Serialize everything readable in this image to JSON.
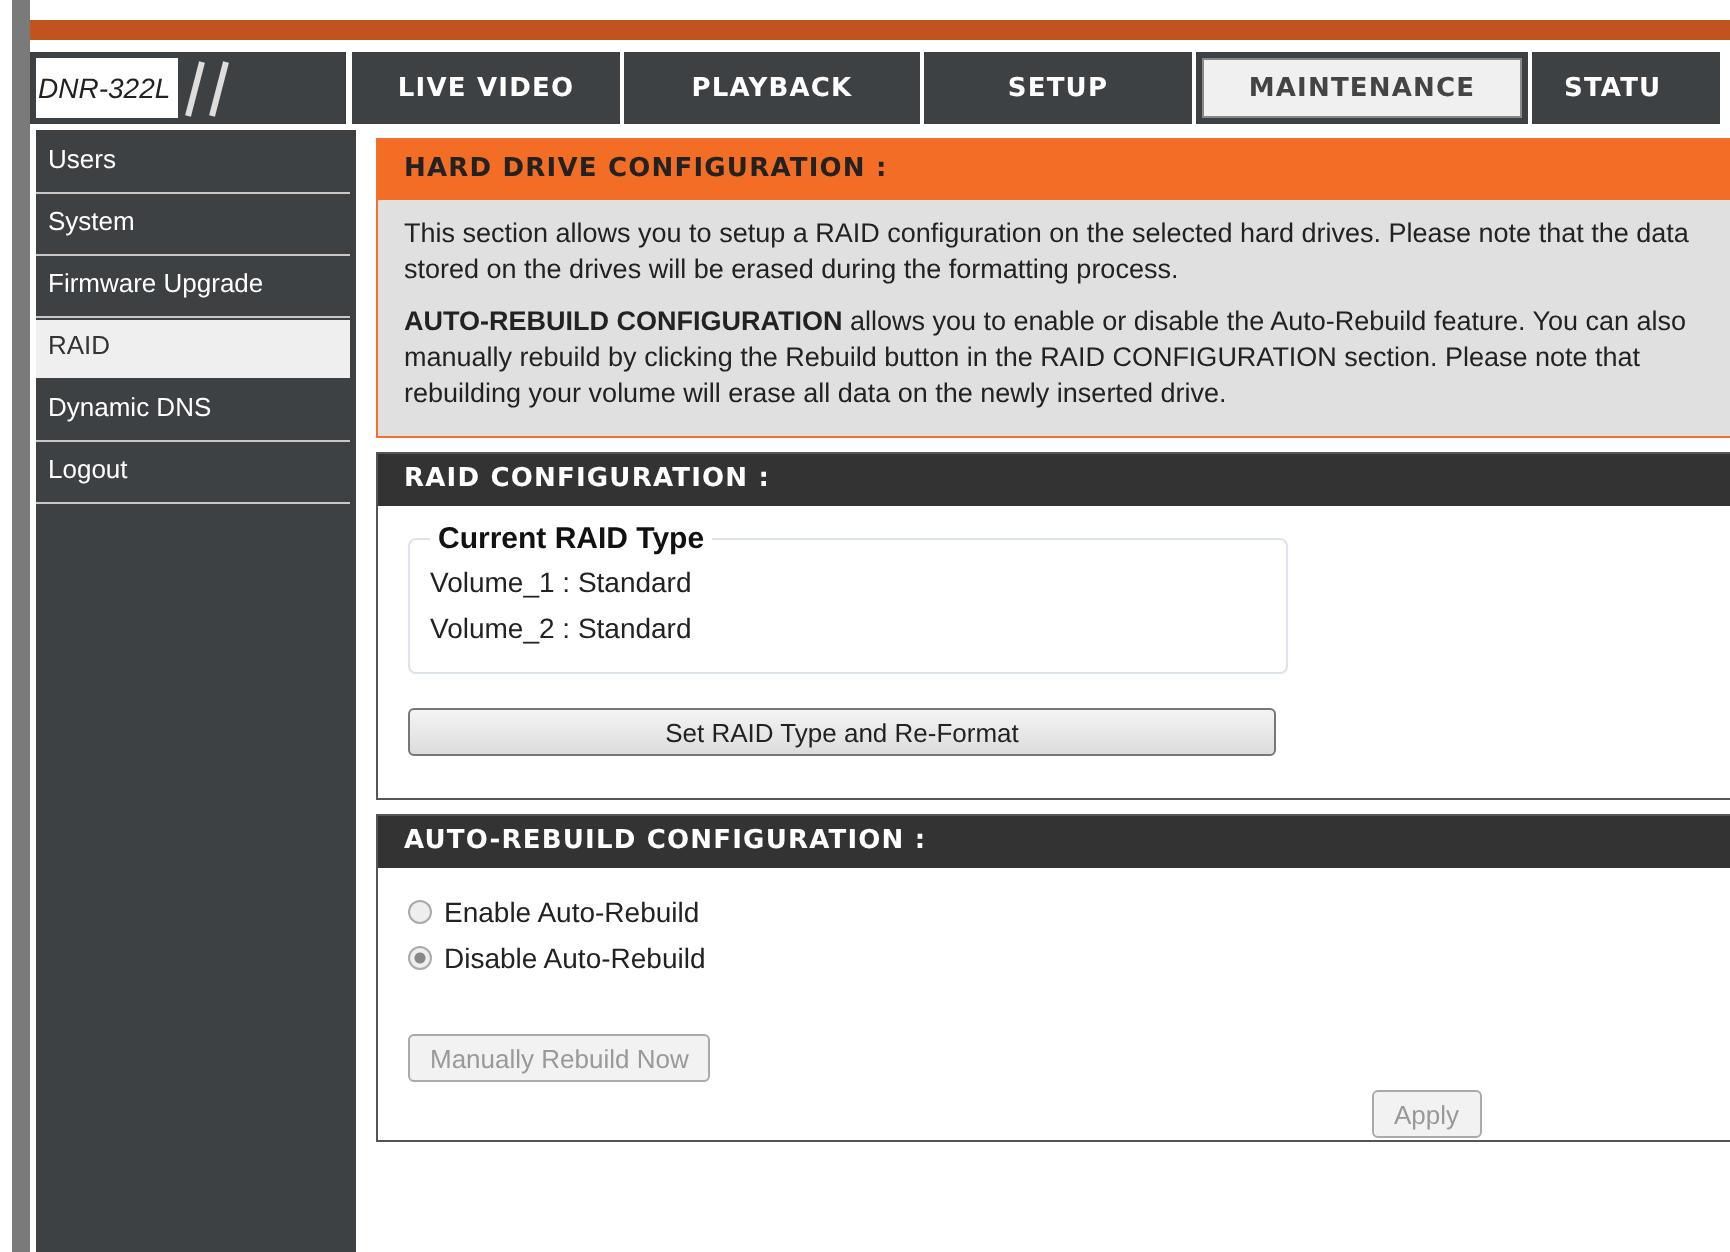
{
  "logo": {
    "text": "DNR-322L"
  },
  "tabs": [
    {
      "label": "LIVE VIDEO",
      "selected": false
    },
    {
      "label": "PLAYBACK",
      "selected": false
    },
    {
      "label": "SETUP",
      "selected": false
    },
    {
      "label": "MAINTENANCE",
      "selected": true
    },
    {
      "label": "STATU",
      "selected": false
    }
  ],
  "sidebar": {
    "items": [
      {
        "label": "Users",
        "selected": false
      },
      {
        "label": "System",
        "selected": false
      },
      {
        "label": "Firmware Upgrade",
        "selected": false
      },
      {
        "label": "RAID",
        "selected": true
      },
      {
        "label": "Dynamic DNS",
        "selected": false
      },
      {
        "label": "Logout",
        "selected": false
      }
    ]
  },
  "intro": {
    "title": "HARD DRIVE CONFIGURATION :",
    "paragraphs": [
      "This section allows you to setup a RAID configuration on the selected hard drives. Please note that the data stored on the drives will be erased during the formatting process.",
      "**AUTO-REBUILD CONFIGURATION** allows you to enable or disable the Auto-Rebuild feature. You can also manually rebuild by clicking the Rebuild button in the RAID CONFIGURATION section. Please note that rebuilding your volume will erase all data on the newly inserted drive."
    ]
  },
  "raid": {
    "title": "RAID CONFIGURATION :",
    "group_title": "Current RAID Type",
    "volumes": [
      "Volume_1 : Standard",
      "Volume_2 : Standard"
    ],
    "button": {
      "label": "Set RAID Type and Re-Format",
      "disabled": false
    }
  },
  "auto_rebuild": {
    "title": "AUTO-REBUILD CONFIGURATION :",
    "options": [
      {
        "label": "Enable Auto-Rebuild",
        "selected": false
      },
      {
        "label": "Disable Auto-Rebuild",
        "selected": true
      }
    ],
    "rebuild_button": {
      "label": "Manually Rebuild Now",
      "disabled": true
    },
    "apply_button": {
      "label": "Apply",
      "disabled": true
    }
  }
}
